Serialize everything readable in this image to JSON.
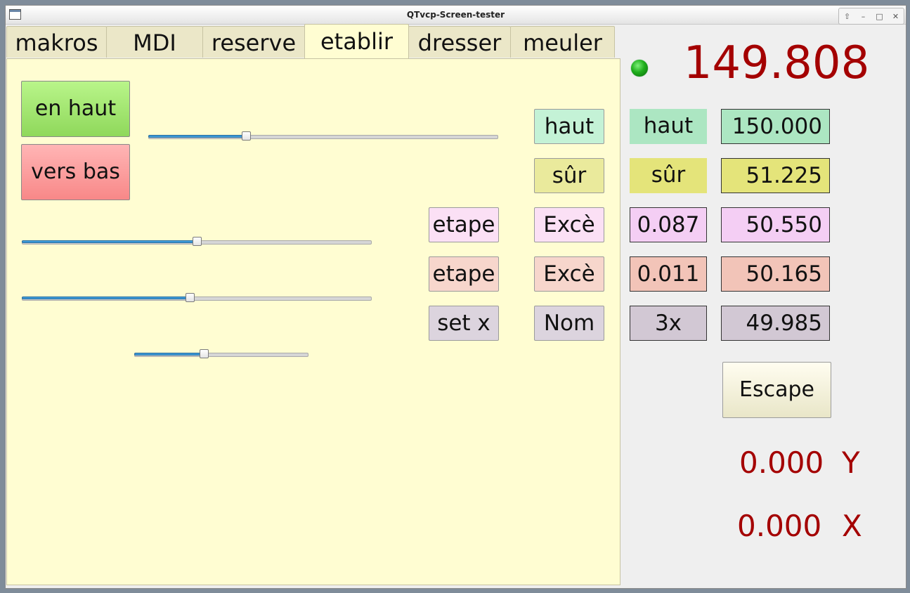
{
  "window": {
    "title": "QTvcp-Screen-tester",
    "buttons": [
      "⇧",
      "–",
      "□",
      "✕"
    ]
  },
  "tabs": [
    {
      "label": "makros",
      "active": false
    },
    {
      "label": "MDI",
      "active": false
    },
    {
      "label": "reserve",
      "active": false
    },
    {
      "label": "etablir",
      "active": true
    },
    {
      "label": "dresser",
      "active": false
    },
    {
      "label": "meuler",
      "active": false
    }
  ],
  "panel": {
    "btn_up": "en haut",
    "btn_down": "vers bas",
    "sliders": [
      0.28,
      0.5,
      0.48,
      0.4
    ],
    "rows": [
      {
        "left_btn": null,
        "mid_btn": "haut",
        "label": "haut",
        "value": "150.000",
        "colors": {
          "mid": "#c4f2d6",
          "label": "#ace6c2",
          "value": "#ace6c2"
        }
      },
      {
        "left_btn": null,
        "mid_btn": "sûr",
        "label": "sûr",
        "value": "51.225",
        "colors": {
          "mid": "#eaea9c",
          "label": "#e4e47a",
          "value": "#e4e47a"
        }
      },
      {
        "left_btn": "etape",
        "mid_btn": "Excè",
        "label": "0.087",
        "value": "50.550",
        "colors": {
          "left": "#fbe0f5",
          "mid": "#fbe0f5",
          "label": "#f4cef4",
          "value": "#f4cef4"
        }
      },
      {
        "left_btn": "etape",
        "mid_btn": "Excè",
        "label": "0.011",
        "value": "50.165",
        "colors": {
          "left": "#f7d6cc",
          "mid": "#f7d6cc",
          "label": "#f2c4b8",
          "value": "#f2c4b8"
        }
      },
      {
        "left_btn": "set x",
        "mid_btn": "Nom",
        "label": "3x",
        "value": "49.985",
        "colors": {
          "left": "#dcd4de",
          "mid": "#dcd4de",
          "label": "#d2c8d4",
          "value": "#d2c8d4"
        }
      }
    ]
  },
  "right": {
    "main_readout": "149.808",
    "led_color": "#1fae1c",
    "escape_label": "Escape",
    "y_value": "0.000",
    "y_axis": "Y",
    "x_value": "0.000",
    "x_axis": "X"
  }
}
